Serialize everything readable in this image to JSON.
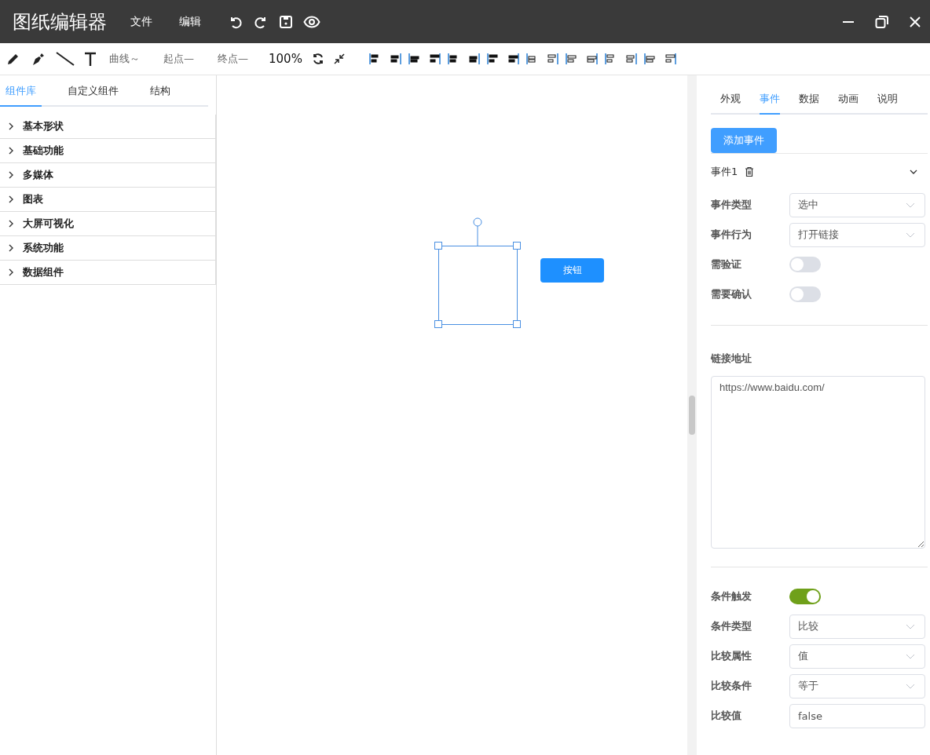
{
  "title_bar": {
    "app_title": "图纸编辑器",
    "menus": [
      "文件",
      "编辑"
    ]
  },
  "toolbar": {
    "curve_style": "曲线～",
    "start_marker": "起点—",
    "end_marker": "终点—",
    "zoom": "100%"
  },
  "left_panel": {
    "tabs": [
      {
        "label": "组件库",
        "selected": true
      },
      {
        "label": "自定义组件",
        "selected": false
      },
      {
        "label": "结构",
        "selected": false
      }
    ],
    "groups": [
      {
        "label": "基本形状",
        "expanded": false
      },
      {
        "label": "基础功能",
        "expanded": false
      },
      {
        "label": "多媒体",
        "expanded": false
      },
      {
        "label": "图表",
        "expanded": false
      },
      {
        "label": "大屏可视化",
        "expanded": false
      },
      {
        "label": "系统功能",
        "expanded": false
      },
      {
        "label": "数据组件",
        "expanded": false
      }
    ]
  },
  "canvas": {
    "button_label": "按钮"
  },
  "right_panel": {
    "tabs": [
      {
        "label": "外观",
        "selected": false
      },
      {
        "label": "事件",
        "selected": true
      },
      {
        "label": "数据",
        "selected": false
      },
      {
        "label": "动画",
        "selected": false
      },
      {
        "label": "说明",
        "selected": false
      }
    ],
    "add_event_button": "添加事件",
    "event": {
      "title": "事件1",
      "expanded": true,
      "fields": [
        {
          "kind": "select",
          "label": "事件类型",
          "value": "选中"
        },
        {
          "kind": "select",
          "label": "事件行为",
          "value": "打开链接"
        },
        {
          "kind": "switch",
          "label": "需验证",
          "on": false
        },
        {
          "kind": "switch",
          "label": "需要确认",
          "on": false
        }
      ],
      "link": {
        "label": "链接地址",
        "value": "https://www.baidu.com/"
      },
      "condition_fields": [
        {
          "kind": "switch",
          "label": "条件触发",
          "on": true
        },
        {
          "kind": "select",
          "label": "条件类型",
          "value": "比较"
        },
        {
          "kind": "select",
          "label": "比较属性",
          "value": "值"
        },
        {
          "kind": "select",
          "label": "比较条件",
          "value": "等于"
        },
        {
          "kind": "input",
          "label": "比较值",
          "value": "false"
        }
      ]
    }
  }
}
